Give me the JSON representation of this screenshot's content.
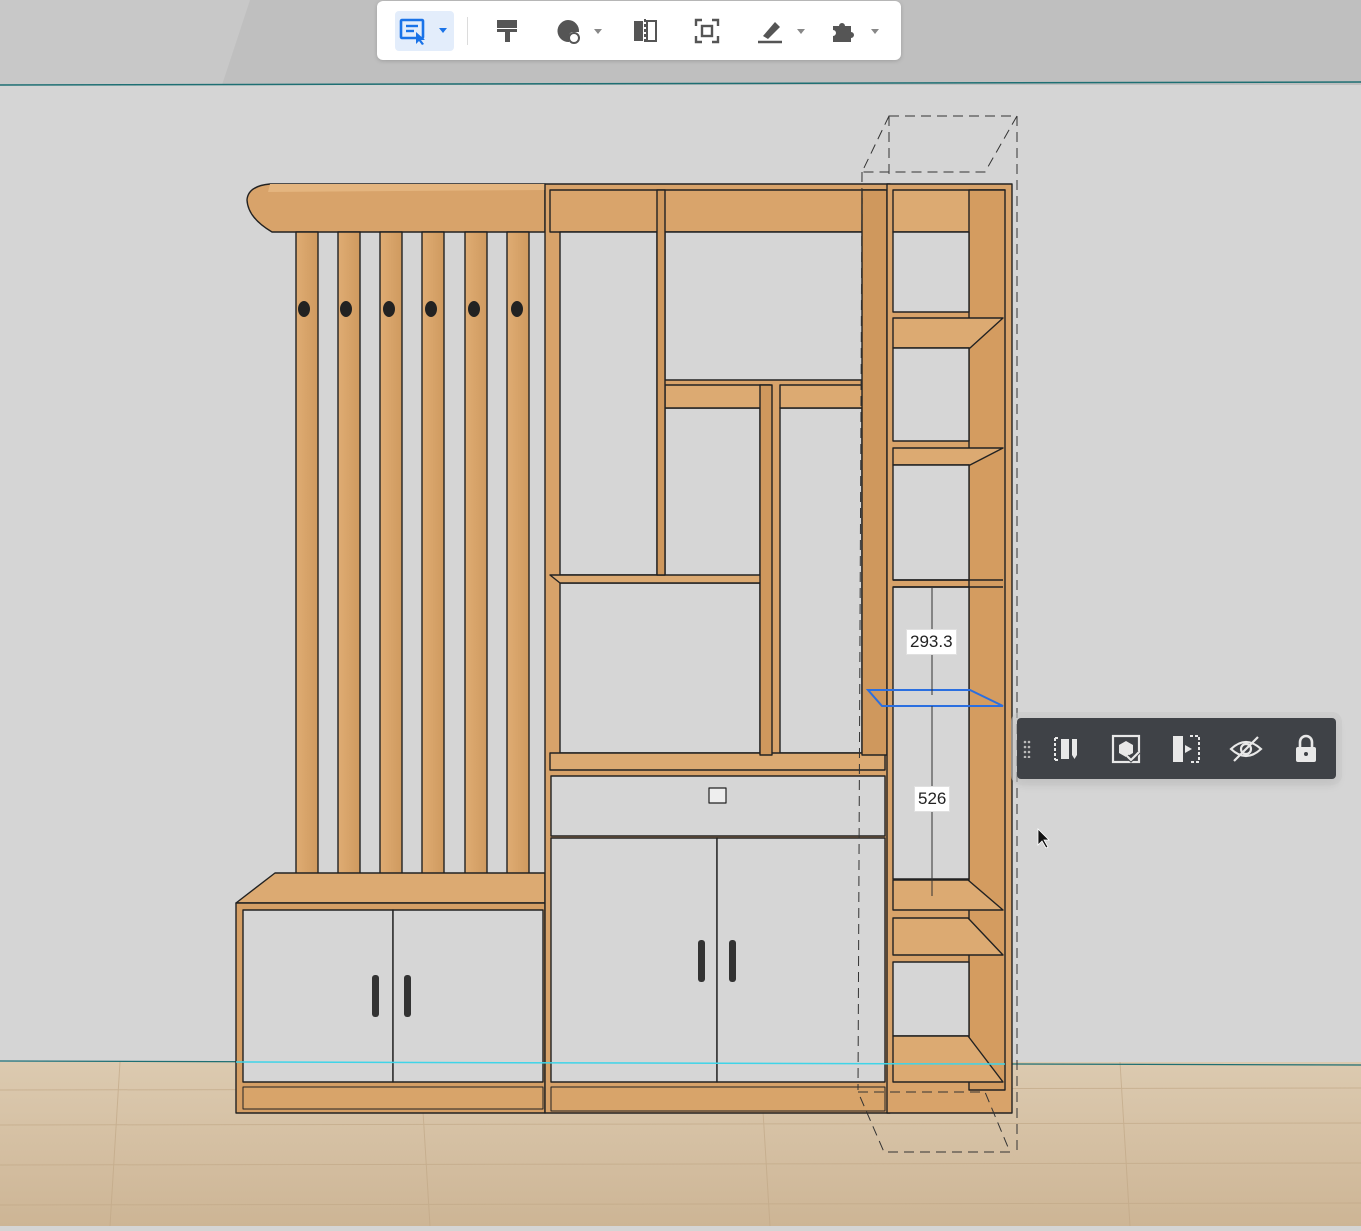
{
  "toolbar": {
    "tools": [
      {
        "name": "comment-select",
        "has_dropdown": true,
        "active": true
      },
      {
        "name": "format-painter",
        "has_dropdown": false
      },
      {
        "name": "material-palette",
        "has_dropdown": true
      },
      {
        "name": "mirror",
        "has_dropdown": false
      },
      {
        "name": "focus-frame",
        "has_dropdown": false
      },
      {
        "name": "brush-tool",
        "has_dropdown": true
      },
      {
        "name": "plugin",
        "has_dropdown": true
      }
    ]
  },
  "dimensions": {
    "upper_gap": "293.3",
    "lower_gap": "526"
  },
  "context_toolbar": {
    "actions": [
      "edit-panel-icon",
      "replace-board-icon",
      "align-to-edge-icon",
      "hide-icon",
      "lock-icon"
    ]
  },
  "colors": {
    "wood": "#d9a46a",
    "wood_dark": "#b07a44",
    "wall": "#d5d5d5",
    "floor": "#d8c3a5",
    "selection": "#2b6fe0",
    "accent": "#1a73e8",
    "toolbar_dark": "#3f4247"
  }
}
